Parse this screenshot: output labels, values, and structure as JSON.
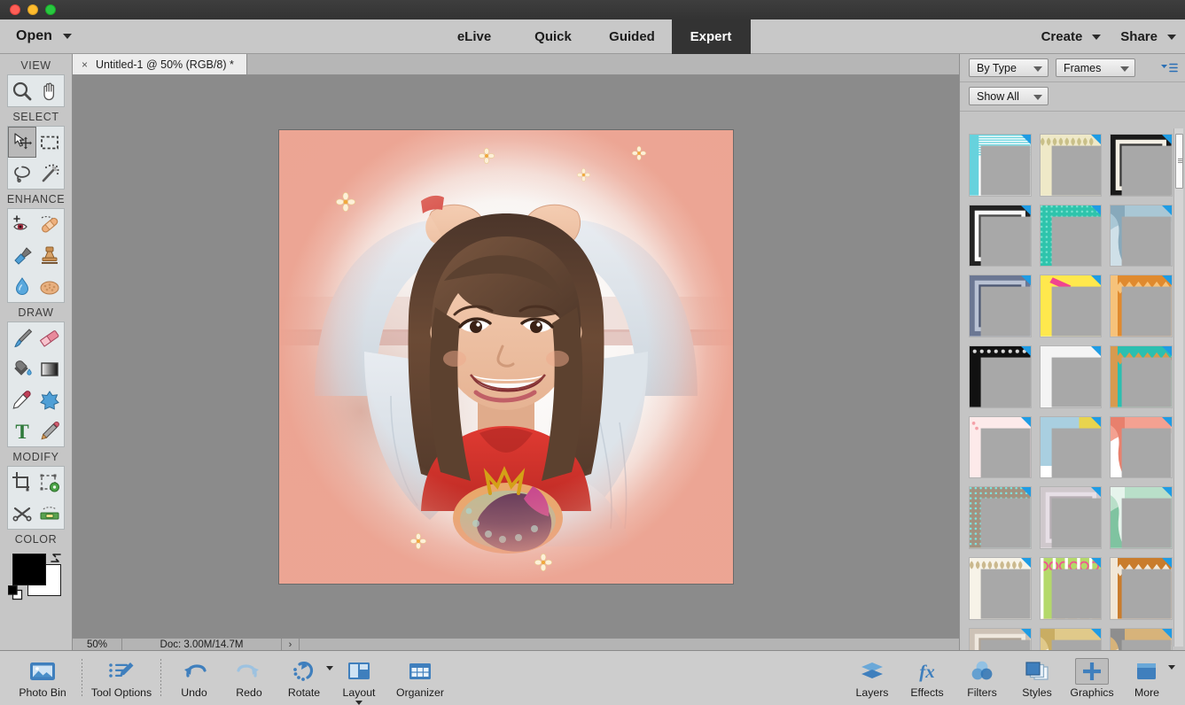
{
  "window": {
    "traffic_lights": [
      "close",
      "minimize",
      "zoom"
    ]
  },
  "menubar": {
    "open_label": "Open",
    "mode_tabs": [
      {
        "label": "eLive",
        "active": false
      },
      {
        "label": "Quick",
        "active": false
      },
      {
        "label": "Guided",
        "active": false
      },
      {
        "label": "Expert",
        "active": true
      }
    ],
    "right_menus": [
      {
        "label": "Create"
      },
      {
        "label": "Share"
      }
    ]
  },
  "toolbar": {
    "sections": [
      {
        "title": "VIEW",
        "tools": [
          {
            "name": "zoom-tool",
            "icon": "magnifier-icon",
            "selected": false
          },
          {
            "name": "hand-tool",
            "icon": "hand-icon",
            "selected": false
          }
        ]
      },
      {
        "title": "SELECT",
        "tools": [
          {
            "name": "move-tool",
            "icon": "move-arrow-icon",
            "selected": true
          },
          {
            "name": "rectangular-marquee-tool",
            "icon": "marquee-icon",
            "selected": false
          },
          {
            "name": "lasso-tool",
            "icon": "lasso-icon",
            "selected": false
          },
          {
            "name": "quick-selection-tool",
            "icon": "magic-wand-icon",
            "selected": false
          }
        ]
      },
      {
        "title": "ENHANCE",
        "tools": [
          {
            "name": "red-eye-removal-tool",
            "icon": "eye-icon",
            "selected": false
          },
          {
            "name": "spot-healing-brush-tool",
            "icon": "bandage-icon",
            "selected": false
          },
          {
            "name": "smart-brush-tool",
            "icon": "paint-sprayer-icon",
            "selected": false
          },
          {
            "name": "clone-stamp-tool",
            "icon": "stamp-icon",
            "selected": false
          },
          {
            "name": "blur-tool",
            "icon": "waterdrop-icon",
            "selected": false
          },
          {
            "name": "sponge-tool",
            "icon": "sponge-icon",
            "selected": false
          }
        ]
      },
      {
        "title": "DRAW",
        "tools": [
          {
            "name": "brush-tool",
            "icon": "paintbrush-icon",
            "selected": false
          },
          {
            "name": "eraser-tool",
            "icon": "eraser-icon",
            "selected": false
          },
          {
            "name": "paint-bucket-tool",
            "icon": "paint-bucket-icon",
            "selected": false
          },
          {
            "name": "gradient-tool",
            "icon": "gradient-icon",
            "selected": false
          },
          {
            "name": "color-picker-tool",
            "icon": "eyedropper-icon",
            "selected": false
          },
          {
            "name": "custom-shape-tool",
            "icon": "shape-blob-icon",
            "selected": false
          },
          {
            "name": "type-tool",
            "icon": "text-t-icon",
            "selected": false
          },
          {
            "name": "pencil-tool",
            "icon": "pencil-icon",
            "selected": false
          }
        ]
      },
      {
        "title": "MODIFY",
        "tools": [
          {
            "name": "crop-tool",
            "icon": "crop-icon",
            "selected": false
          },
          {
            "name": "recompose-tool",
            "icon": "recompose-gear-icon",
            "selected": false
          },
          {
            "name": "content-aware-move-tool",
            "icon": "scissors-move-icon",
            "selected": false
          },
          {
            "name": "straighten-tool",
            "icon": "straighten-level-icon",
            "selected": false
          }
        ]
      }
    ],
    "color_section_title": "COLOR",
    "foreground_color": "#000000",
    "background_color": "#ffffff"
  },
  "document": {
    "tab_title": "Untitled-1 @ 50% (RGB/8) *",
    "close_glyph": "×"
  },
  "statusbar": {
    "zoom": "50%",
    "doc_info": "Doc: 3.00M/14.7M",
    "expand_glyph": "›"
  },
  "graphics_panel": {
    "filter_by": "By Type",
    "category": "Frames",
    "show": "Show All",
    "menu_icon": "panel-options-icon",
    "thumbnails": [
      {
        "id": 1,
        "name": "teal-striped-frame",
        "c1": "#66d2dd",
        "c2": "#ffffff",
        "c3": "#3c6e77",
        "style": "stripes"
      },
      {
        "id": 2,
        "name": "cream-leaf-frame",
        "c1": "#efe9c8",
        "c2": "#ddd6a8",
        "c3": "#c9c089",
        "style": "leafy"
      },
      {
        "id": 3,
        "name": "black-matted-frame",
        "c1": "#1a1a1a",
        "c2": "#f3efe4",
        "c3": "#3a3a3a",
        "style": "mat"
      },
      {
        "id": 4,
        "name": "black-white-mat-frame",
        "c1": "#232323",
        "c2": "#fbfbfb",
        "c3": "#4a4a4a",
        "style": "mat"
      },
      {
        "id": 5,
        "name": "turquoise-dotted-frame",
        "c1": "#2ec4ac",
        "c2": "#76dfcd",
        "c3": "#169a86",
        "style": "dots"
      },
      {
        "id": 6,
        "name": "blue-watercolor-frame",
        "c1": "#a9c7d5",
        "c2": "#cfe0e8",
        "c3": "#87a9bb",
        "style": "wash"
      },
      {
        "id": 7,
        "name": "navy-layered-frame",
        "c1": "#6b7793",
        "c2": "#b9c2d4",
        "c3": "#4d5873",
        "style": "mat"
      },
      {
        "id": 8,
        "name": "yellow-washi-tape-frame",
        "c1": "#ffe84d",
        "c2": "#ffffff",
        "c3": "#f0458f",
        "style": "tape"
      },
      {
        "id": 9,
        "name": "orange-chevron-frame",
        "c1": "#e08a2e",
        "c2": "#f6c27a",
        "c3": "#b86a1c",
        "style": "chevron"
      },
      {
        "id": 10,
        "name": "black-ornate-frame",
        "c1": "#111111",
        "c2": "#d8d8d8",
        "c3": "#2b2b2b",
        "style": "ornate"
      },
      {
        "id": 11,
        "name": "white-rounded-frame",
        "c1": "#f4f4f4",
        "c2": "#ffffff",
        "c3": "#e2e2e2",
        "style": "round"
      },
      {
        "id": 12,
        "name": "teal-chevron-oval-frame",
        "c1": "#2bbfb0",
        "c2": "#d79a4f",
        "c3": "#ffffff",
        "style": "chevron"
      },
      {
        "id": 13,
        "name": "pink-hearts-frame",
        "c1": "#fdeaea",
        "c2": "#f4a0a8",
        "c3": "#ffffff",
        "style": "hearts"
      },
      {
        "id": 14,
        "name": "yellow-blue-corner-frame",
        "c1": "#e8d44e",
        "c2": "#a9cfe0",
        "c3": "#ffffff",
        "style": "corner"
      },
      {
        "id": 15,
        "name": "coral-floral-frame",
        "c1": "#f3a191",
        "c2": "#ffffff",
        "c3": "#e8806d",
        "style": "wash"
      },
      {
        "id": 16,
        "name": "teal-bubbles-frame",
        "c1": "#a29280",
        "c2": "#7fe4e0",
        "c3": "#d4c7b4",
        "style": "dots"
      },
      {
        "id": 17,
        "name": "lavender-wood-frame",
        "c1": "#cfc8cc",
        "c2": "#e7dfe6",
        "c3": "#b7aeb4",
        "style": "mat"
      },
      {
        "id": 18,
        "name": "green-marble-frame",
        "c1": "#b9dfc9",
        "c2": "#7fc3a0",
        "c3": "#e6f4ec",
        "style": "wash"
      },
      {
        "id": 19,
        "name": "beige-butterfly-frame",
        "c1": "#f7f3e8",
        "c2": "#d9c9a6",
        "c3": "#cbb98e",
        "style": "leafy"
      },
      {
        "id": 20,
        "name": "green-swirl-candy-frame",
        "c1": "#b4d96a",
        "c2": "#f0568f",
        "c3": "#ffffff",
        "style": "swirl"
      },
      {
        "id": 21,
        "name": "orange-zigzag-frame",
        "c1": "#c97c2c",
        "c2": "#f1e7d7",
        "c3": "#6b6b6b",
        "style": "chevron"
      },
      {
        "id": 22,
        "name": "taupe-lace-frame",
        "c1": "#cdc2b6",
        "c2": "#efe8de",
        "c3": "#b0a496",
        "style": "mat"
      },
      {
        "id": 23,
        "name": "golden-blur-frame",
        "c1": "#e0c98a",
        "c2": "#f6efdc",
        "c3": "#c9ad63",
        "style": "wash"
      },
      {
        "id": 24,
        "name": "sandy-grunge-frame",
        "c1": "#d7b37a",
        "c2": "#eadcc2",
        "c3": "#8e8e8e",
        "style": "wash"
      }
    ]
  },
  "canvas": {
    "artwork_name": "smiling-girl-with-peach-dotted-frame",
    "frame_color": "#eca391",
    "zoom_percent": "50%"
  },
  "bottombar": {
    "left_items": [
      {
        "label": "Photo Bin",
        "icon": "photo-bin-icon",
        "boxed": false,
        "caret": false
      },
      {
        "label": "Tool Options",
        "icon": "tool-options-icon",
        "boxed": false,
        "caret": false
      },
      {
        "label": "Undo",
        "icon": "undo-arrow-icon",
        "boxed": false,
        "caret": false
      },
      {
        "label": "Redo",
        "icon": "redo-arrow-icon",
        "boxed": false,
        "caret": false
      },
      {
        "label": "Rotate",
        "icon": "rotate-icon",
        "boxed": false,
        "caret": true
      },
      {
        "label": "Layout",
        "icon": "layout-grid-icon",
        "boxed": false,
        "caret": true
      },
      {
        "label": "Organizer",
        "icon": "organizer-grid-icon",
        "boxed": false,
        "caret": false
      }
    ],
    "right_items": [
      {
        "label": "Layers",
        "icon": "layers-icon",
        "boxed": false,
        "caret": false
      },
      {
        "label": "Effects",
        "icon": "effects-fx-icon",
        "boxed": false,
        "caret": false
      },
      {
        "label": "Filters",
        "icon": "filters-circles-icon",
        "boxed": false,
        "caret": false
      },
      {
        "label": "Styles",
        "icon": "styles-stack-icon",
        "boxed": false,
        "caret": false
      },
      {
        "label": "Graphics",
        "icon": "graphics-plus-icon",
        "boxed": true,
        "caret": false
      },
      {
        "label": "More",
        "icon": "more-panel-icon",
        "boxed": false,
        "caret": true
      }
    ]
  }
}
